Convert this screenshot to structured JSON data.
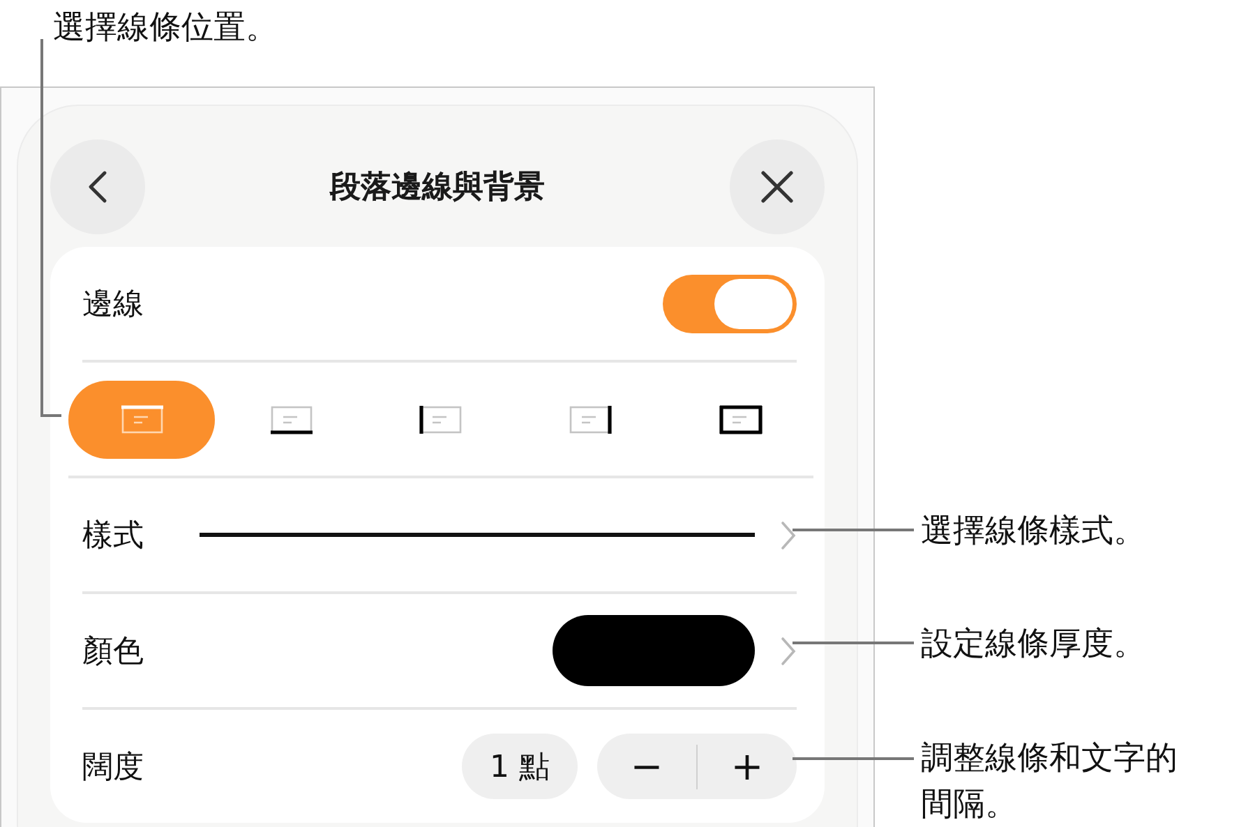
{
  "callouts": [
    {
      "text": "選擇線條位置。"
    },
    {
      "text": "選擇線條樣式。"
    },
    {
      "text": "設定線條厚度。"
    },
    {
      "text": "調整線條和文字的間隔。"
    }
  ],
  "header": {
    "title": "段落邊線與背景"
  },
  "borders": {
    "label": "邊線",
    "on": true
  },
  "positions": [
    {
      "kind": "top",
      "selected": true
    },
    {
      "kind": "bottom",
      "selected": false
    },
    {
      "kind": "left",
      "selected": false
    },
    {
      "kind": "right",
      "selected": false
    },
    {
      "kind": "box",
      "selected": false
    }
  ],
  "style": {
    "label": "樣式"
  },
  "color": {
    "label": "顏色"
  },
  "width": {
    "label": "闊度",
    "value": "1 點",
    "decrement": "−",
    "increment": "+"
  }
}
